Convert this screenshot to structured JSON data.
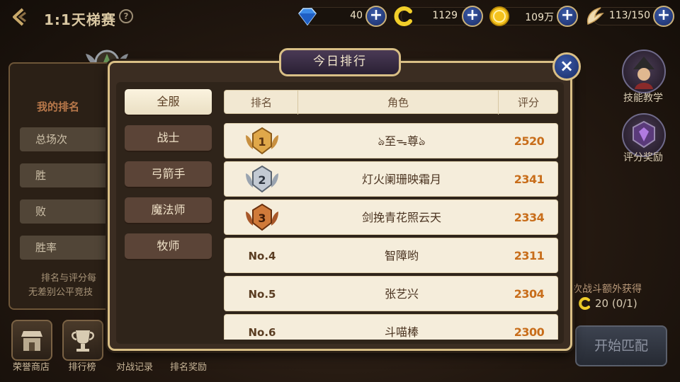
{
  "header": {
    "title": "1:1天梯赛",
    "help": "?",
    "resources": [
      {
        "icon": "diamond-icon",
        "value": "40"
      },
      {
        "icon": "honor-coin-icon",
        "value": "1129"
      },
      {
        "icon": "gold-coin-icon",
        "value": "109万"
      },
      {
        "icon": "wing-stamina-icon",
        "value": "113/150"
      }
    ],
    "plus": "+"
  },
  "left_panel": {
    "my_rank_label": "我的排名",
    "stats": [
      "总场次",
      "胜",
      "败",
      "胜率"
    ],
    "note_line1": "排名与评分每",
    "note_line2": "无差别公平竞技"
  },
  "bottom_buttons": [
    {
      "label": "荣誉商店",
      "icon": "shop-icon"
    },
    {
      "label": "排行榜",
      "icon": "trophy-icon"
    },
    {
      "label": "对战记录",
      "icon": "record-icon"
    },
    {
      "label": "排名奖励",
      "icon": "reward-icon"
    }
  ],
  "right_side": {
    "skill_tutorial": "技能教学",
    "score_reward": "评分奖励",
    "extra_reward_text": "次战斗额外获得",
    "extra_reward_value": "20 (0/1)",
    "start_match": "开始匹配"
  },
  "modal": {
    "title": "今日排行",
    "close": "×",
    "categories": [
      {
        "label": "全服",
        "active": true
      },
      {
        "label": "战士",
        "active": false
      },
      {
        "label": "弓箭手",
        "active": false
      },
      {
        "label": "魔法师",
        "active": false
      },
      {
        "label": "牧师",
        "active": false
      }
    ],
    "columns": {
      "rank": "排名",
      "role": "角色",
      "score": "评分"
    },
    "rows": [
      {
        "rank": "1",
        "medal": "gold",
        "name": "ঌ至ᯓ尊ঌ",
        "score": "2520"
      },
      {
        "rank": "2",
        "medal": "silver",
        "name": "灯火阑珊映霜月",
        "score": "2341"
      },
      {
        "rank": "3",
        "medal": "bronze",
        "name": "剑挽青花照云天",
        "score": "2334"
      },
      {
        "rank": "No.4",
        "medal": "",
        "name": "智障哟",
        "score": "2311"
      },
      {
        "rank": "No.5",
        "medal": "",
        "name": "张艺兴",
        "score": "2304"
      },
      {
        "rank": "No.6",
        "medal": "",
        "name": "斗喵棒",
        "score": "2300"
      }
    ]
  },
  "colors": {
    "frame_gold": "#d9bf86",
    "score_orange": "#c86d1a",
    "plus_blue": "#2a4590",
    "active_tab": "#f5eddb"
  }
}
